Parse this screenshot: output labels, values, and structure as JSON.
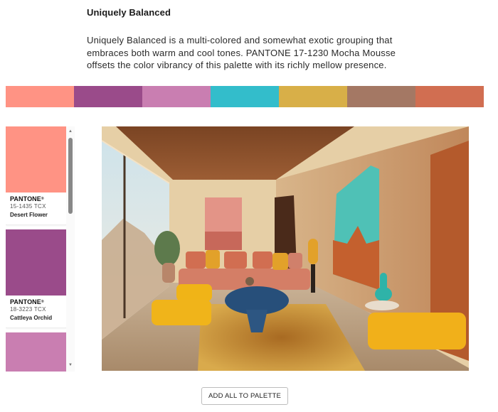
{
  "palette": {
    "title": "Uniquely Balanced",
    "description": "Uniquely Balanced is a multi-colored and somewhat exotic grouping that\nembraces both warm and cool tones.  PANTONE 17-1230 Mocha Mousse\noffsets the color vibrancy of this palette with its richly mellow presence.",
    "colors": [
      {
        "hex": "#FF9384"
      },
      {
        "hex": "#9A4B8A"
      },
      {
        "hex": "#C97EB1"
      },
      {
        "hex": "#33BDCB"
      },
      {
        "hex": "#D8AF48"
      },
      {
        "hex": "#A47864"
      },
      {
        "hex": "#D16E51"
      }
    ]
  },
  "swatch_cards": [
    {
      "brand": "PANTONE",
      "reg": "®",
      "code": "15-1435 TCX",
      "name": "Desert Flower",
      "hex": "#FF9384"
    },
    {
      "brand": "PANTONE",
      "reg": "®",
      "code": "18-3223 TCX",
      "name": "Cattleya Orchid",
      "hex": "#9A4B8A"
    },
    {
      "hex": "#C97EB1"
    }
  ],
  "scrollbar": {
    "up_icon": "▲",
    "down_icon": "▼"
  },
  "image": {
    "alt": "Modern desert living room interior with coral sofa, yellow ottomans, blue coffee table and turquoise wall art"
  },
  "actions": {
    "add_all_label": "ADD ALL TO PALETTE"
  }
}
